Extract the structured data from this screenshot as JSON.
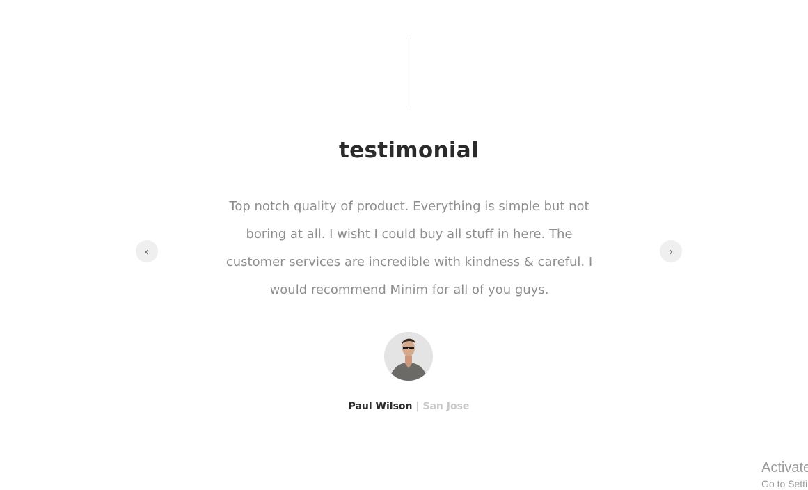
{
  "section": {
    "title": "testimonial"
  },
  "testimonial": {
    "quote": "Top notch quality of product. Everything is simple but not boring at all. I wisht I could buy all stuff in here. The customer services are incredible with kindness & careful. I would recommend Minim for all of you guys.",
    "author_name": "Paul Wilson",
    "author_separator": " | ",
    "author_location": "San Jose"
  },
  "navigation": {
    "prev_icon": "chevron-left-icon",
    "next_icon": "chevron-right-icon"
  },
  "watermark": {
    "title": "Activate Windows",
    "subtitle": "Go to Settings to activate Windows."
  },
  "colors": {
    "title": "#2b2b2b",
    "quote_text": "#8e8e8e",
    "author_location": "#c8c8c8",
    "nav_button_bg": "#efefef",
    "divider": "#cfcfcf"
  }
}
